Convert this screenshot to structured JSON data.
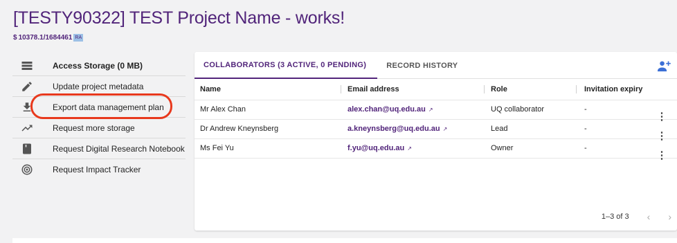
{
  "project": {
    "title": "[TESTY90322] TEST Project Name - works!",
    "doi": "10378.1/1684461",
    "doi_badge": "RA"
  },
  "menu": {
    "items": [
      {
        "label": "Access Storage (0 MB)",
        "icon": "storage-icon"
      },
      {
        "label": "Update project metadata",
        "icon": "pencil-icon"
      },
      {
        "label": "Export data management plan",
        "icon": "download-icon"
      },
      {
        "label": "Request more storage",
        "icon": "trending-up-icon"
      },
      {
        "label": "Request Digital Research Notebook",
        "icon": "notebook-icon"
      },
      {
        "label": "Request Impact Tracker",
        "icon": "radar-icon"
      }
    ]
  },
  "tabs": [
    {
      "label": "COLLABORATORS (3 ACTIVE, 0 PENDING)",
      "active": true
    },
    {
      "label": "RECORD HISTORY",
      "active": false
    }
  ],
  "table": {
    "headers": [
      "Name",
      "Email address",
      "Role",
      "Invitation expiry"
    ],
    "rows": [
      {
        "name": "Mr Alex Chan",
        "email": "alex.chan@uq.edu.au",
        "role": "UQ collaborator",
        "expiry": "-"
      },
      {
        "name": "Dr Andrew Kneynsberg",
        "email": "a.kneynsberg@uq.edu.au",
        "role": "Lead",
        "expiry": "-"
      },
      {
        "name": "Ms Fei Yu",
        "email": "f.yu@uq.edu.au",
        "role": "Owner",
        "expiry": "-"
      }
    ]
  },
  "pagination": {
    "range": "1–3 of 3",
    "prev": "‹",
    "next": "›"
  },
  "colors": {
    "accent": "#51247a",
    "highlight": "#e8391d",
    "add_user": "#3b6fd6"
  }
}
